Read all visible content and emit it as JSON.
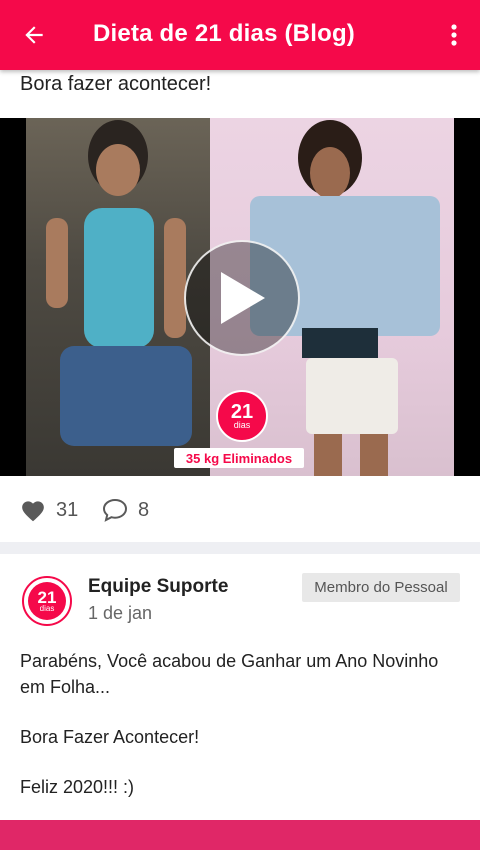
{
  "appbar": {
    "title": "Dieta de 21 dias (Blog)",
    "back_icon": "arrow-left-icon",
    "menu_icon": "more-vertical-icon",
    "color": "#f5094a"
  },
  "post": {
    "text": "Bora fazer acontecer!",
    "media": {
      "badge_number": "21",
      "badge_sub": "dias",
      "banner": "35 kg Eliminados"
    },
    "likes": "31",
    "comments": "8"
  },
  "comment": {
    "avatar_number": "21",
    "avatar_sub": "dias",
    "author": "Equipe Suporte",
    "date": "1 de jan",
    "role": "Membro do Pessoal",
    "lines": [
      "Parabéns, Você acabou de Ganhar um Ano Novinho em Folha...",
      "Bora Fazer Acontecer!",
      "Feliz 2020!!! :)"
    ]
  },
  "bottom_bar_color": "#e02767"
}
